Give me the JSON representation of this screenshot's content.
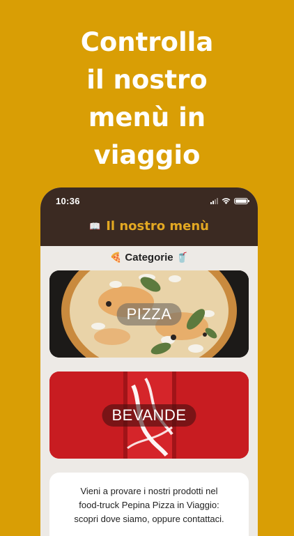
{
  "headline": [
    "Controlla",
    "il nostro",
    "menù in",
    "viaggio"
  ],
  "status_bar": {
    "time": "10:36"
  },
  "app_bar": {
    "icon": "book-icon",
    "title": "Il nostro menù"
  },
  "categories": {
    "label": "Categorie",
    "left_icon": "pizza-icon",
    "right_icon": "drink-icon"
  },
  "cards": [
    {
      "label": "PIZZA",
      "image": "pizza-photo"
    },
    {
      "label": "BEVANDE",
      "image": "cola-can-photo"
    }
  ],
  "info_text": [
    "Vieni a provare i nostri prodotti nel",
    "food-truck Pepina Pizza in Viaggio:",
    "scopri dove siamo, oppure contattaci."
  ],
  "colors": {
    "background": "#D99E05",
    "app_bar": "#3B2A22",
    "title": "#E3A822",
    "drink_card": "#C81C21"
  }
}
